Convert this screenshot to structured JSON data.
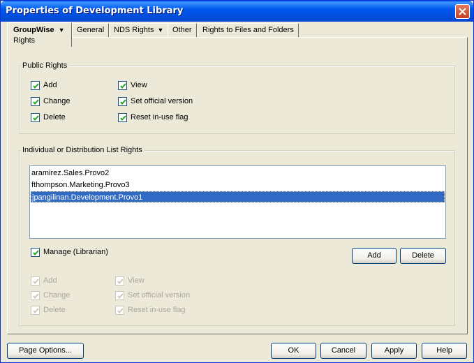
{
  "window": {
    "title": "Properties of Development Library"
  },
  "tabs": {
    "active": {
      "label": "GroupWise",
      "sublabel": "Rights"
    },
    "general": "General",
    "nds_rights": "NDS Rights",
    "other": "Other",
    "rights_files": "Rights to Files and Folders"
  },
  "public_rights": {
    "legend": "Public Rights",
    "add": "Add",
    "change": "Change",
    "delete": "Delete",
    "view": "View",
    "set_official": "Set official version",
    "reset_inuse": "Reset in-use flag"
  },
  "individual_rights": {
    "legend": "Individual or Distribution List Rights",
    "users": [
      "aramirez.Sales.Provo2",
      "fthompson.Marketing.Provo3",
      "jpangilinan.Development.Provo1"
    ],
    "selected_index": 2,
    "manage_label": "Manage (Librarian)",
    "add_button": "Add",
    "delete_button": "Delete",
    "add": "Add",
    "change": "Change",
    "delete": "Delete",
    "view": "View",
    "set_official": "Set official version",
    "reset_inuse": "Reset in-use flag"
  },
  "footer": {
    "page_options": "Page Options...",
    "ok": "OK",
    "cancel": "Cancel",
    "apply": "Apply",
    "help": "Help"
  }
}
